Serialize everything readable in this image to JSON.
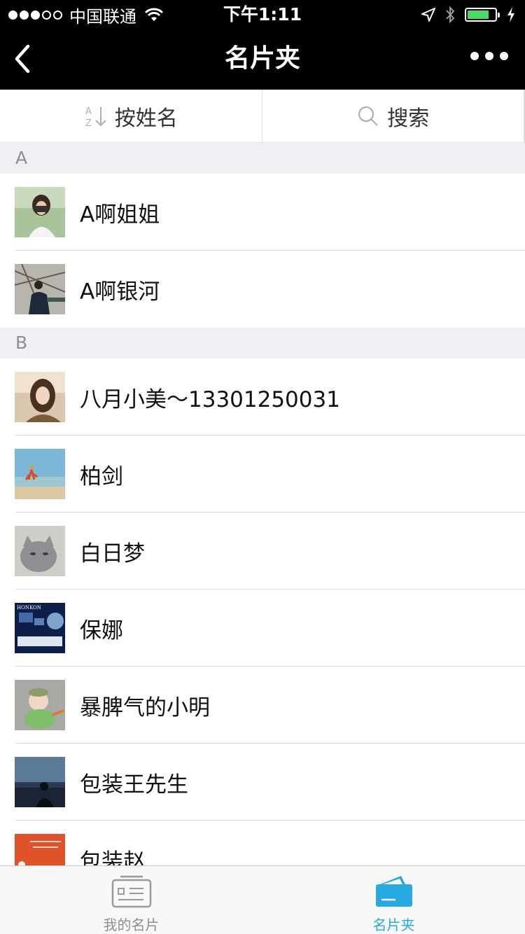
{
  "status_bar": {
    "carrier": "中国联通",
    "time": "下午1:11"
  },
  "nav": {
    "title": "名片夹"
  },
  "toolbar": {
    "sort_label": "按姓名",
    "search_label": "搜索"
  },
  "sections": [
    {
      "letter": "A",
      "contacts": [
        {
          "name": "A啊姐姐"
        },
        {
          "name": "A啊银河"
        }
      ]
    },
    {
      "letter": "B",
      "contacts": [
        {
          "name": "八月小美～13301250031"
        },
        {
          "name": "柏剑"
        },
        {
          "name": "白日梦"
        },
        {
          "name": "保娜"
        },
        {
          "name": "暴脾气的小明"
        },
        {
          "name": "包装王先生"
        },
        {
          "name": "包装赵"
        }
      ]
    }
  ],
  "tabs": [
    {
      "label": "我的名片"
    },
    {
      "label": "名片夹"
    }
  ],
  "colors": {
    "accent": "#27aae1",
    "section_bg": "#efeff4",
    "nav_bg": "#000000"
  }
}
